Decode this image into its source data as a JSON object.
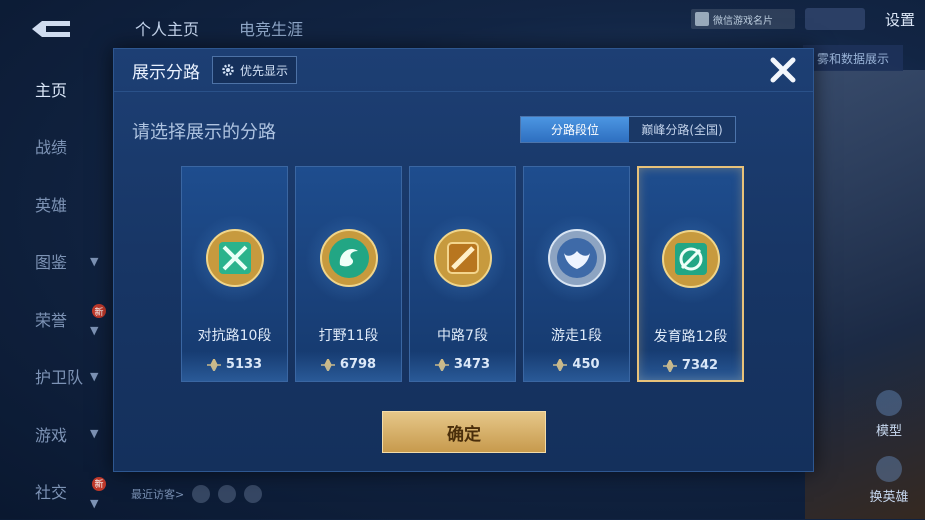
{
  "header": {
    "tabs": [
      "个人主页",
      "电竞生涯"
    ],
    "wechat_card_label": "微信游戏名片",
    "settings_label": "设置"
  },
  "sidebar": {
    "items": [
      {
        "label": "主页",
        "chevron": false,
        "new": false
      },
      {
        "label": "战绩",
        "chevron": false,
        "new": false
      },
      {
        "label": "英雄",
        "chevron": false,
        "new": false
      },
      {
        "label": "图鉴",
        "chevron": true,
        "new": false
      },
      {
        "label": "荣誉",
        "chevron": true,
        "new": true
      },
      {
        "label": "护卫队",
        "chevron": true,
        "new": false
      },
      {
        "label": "游戏",
        "chevron": true,
        "new": false
      },
      {
        "label": "社交",
        "chevron": true,
        "new": true
      }
    ],
    "new_badge": "新"
  },
  "right_panel": {
    "hero_data_tab": "雾和数据展示",
    "model_label": "模型",
    "swap_label": "换英雄"
  },
  "footer": {
    "recent_visitors": "最近访客>"
  },
  "modal": {
    "title": "展示分路",
    "priority_label": "优先显示",
    "prompt": "请选择展示的分路",
    "segments": {
      "active": "分路段位",
      "inactive": "巅峰分路(全国)"
    },
    "cards": [
      {
        "rank": "对抗路10段",
        "score": "5133",
        "emblem": "sword-emblem-icon",
        "selected": false
      },
      {
        "rank": "打野11段",
        "score": "6798",
        "emblem": "dragon-emblem-icon",
        "selected": false
      },
      {
        "rank": "中路7段",
        "score": "3473",
        "emblem": "staff-emblem-icon",
        "selected": false
      },
      {
        "rank": "游走1段",
        "score": "450",
        "emblem": "wings-emblem-icon",
        "selected": false
      },
      {
        "rank": "发育路12段",
        "score": "7342",
        "emblem": "arrow-emblem-icon",
        "selected": true
      }
    ],
    "confirm_label": "确定"
  },
  "colors": {
    "accent_gold": "#e8c27a",
    "segment_active": "#3a82d2",
    "modal_bg": "#1b3b6e"
  }
}
